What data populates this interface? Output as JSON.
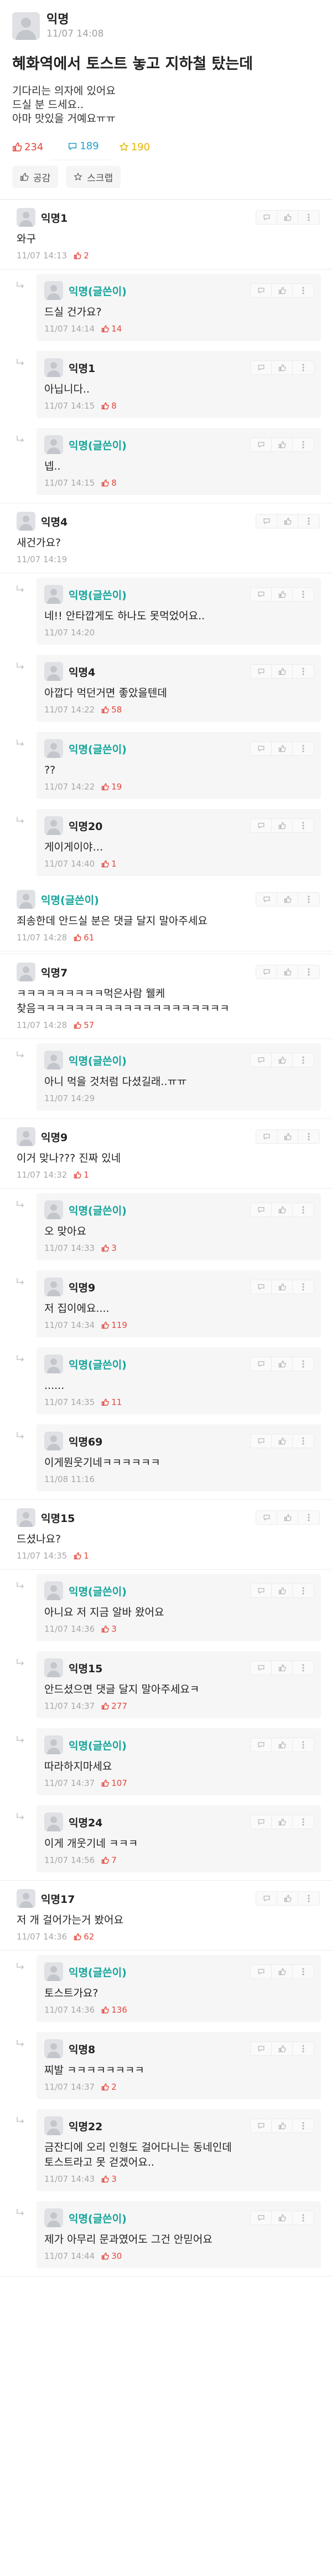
{
  "post": {
    "author": "익명",
    "date": "11/07 14:08",
    "title": "혜화역에서 토스트 놓고 지하철 탔는데",
    "body": [
      "기다리는 의자에 있어요",
      "드실 분 드세요..",
      "아마 맛있을 거예요ㅠㅠ"
    ],
    "likes": "234",
    "comments": "189",
    "scraps": "190",
    "like_button": "공감",
    "scrap_button": "스크랩"
  },
  "icons": {
    "comment_tool": "speech-bubble-icon",
    "like_tool": "thumbs-up-icon",
    "more_tool": "more-vertical-icon"
  },
  "colors": {
    "like": "#e4463b",
    "comment": "#1ea0c8",
    "scrap": "#e6b400",
    "op_name": "#16a59a"
  },
  "comments": [
    {
      "name": "익명1",
      "text": "와구",
      "time": "11/07 14:13",
      "likes": "2",
      "replies": [
        {
          "name": "익명(글쓴이)",
          "op": true,
          "text": "드실 건가요?",
          "time": "11/07 14:14",
          "likes": "14"
        },
        {
          "name": "익명1",
          "op": false,
          "text": "아닙니다..",
          "time": "11/07 14:15",
          "likes": "8"
        },
        {
          "name": "익명(글쓴이)",
          "op": true,
          "text": "넵..",
          "time": "11/07 14:15",
          "likes": "8"
        }
      ]
    },
    {
      "name": "익명4",
      "text": "새건가요?",
      "time": "11/07 14:19",
      "likes": "",
      "replies": [
        {
          "name": "익명(글쓴이)",
          "op": true,
          "text": "네!! 안타깝게도 하나도 못먹었어요..",
          "time": "11/07 14:20",
          "likes": ""
        },
        {
          "name": "익명4",
          "op": false,
          "text": "아깝다 먹던거면 좋았을텐데",
          "time": "11/07 14:22",
          "likes": "58"
        },
        {
          "name": "익명(글쓴이)",
          "op": true,
          "text": "??",
          "time": "11/07 14:22",
          "likes": "19"
        },
        {
          "name": "익명20",
          "op": false,
          "text": "게이게이야…",
          "time": "11/07 14:40",
          "likes": "1"
        },
        {
          "name": "익명(글쓴이)",
          "op": true,
          "text": "죄송한데 안드실 분은 댓글 달지 말아주세요",
          "time": "11/07 14:28",
          "likes": "61",
          "flat": true
        }
      ]
    },
    {
      "name": "익명7",
      "text": "ㅋㅋㅋㅋㅋㅋㅋㅋㅋ먹은사람 웰케",
      "text2": "찾음ㅋㅋㅋㅋㅋㅋㅋㅋㅋㅋㅋㅋㅋㅋㅋㅋㅋㅋㅋㅋ",
      "time": "11/07 14:28",
      "likes": "57",
      "replies": [
        {
          "name": "익명(글쓴이)",
          "op": true,
          "text": "아니 먹을 것처럼 다셨길래..ㅠㅠ",
          "time": "11/07 14:29",
          "likes": ""
        }
      ]
    },
    {
      "name": "익명9",
      "text": "이거 맞나??? 진짜 있네",
      "time": "11/07 14:32",
      "likes": "1",
      "replies": [
        {
          "name": "익명(글쓴이)",
          "op": true,
          "text": "오 맞아요",
          "time": "11/07 14:33",
          "likes": "3"
        },
        {
          "name": "익명9",
          "op": false,
          "text": "저 집이에요....",
          "time": "11/07 14:34",
          "likes": "119"
        },
        {
          "name": "익명(글쓴이)",
          "op": true,
          "text": "......",
          "time": "11/07 14:35",
          "likes": "11"
        },
        {
          "name": "익명69",
          "op": false,
          "text": "이게뭔웃기네ㅋㅋㅋㅋㅋㅋ",
          "time": "11/08 11:16",
          "likes": ""
        }
      ]
    },
    {
      "name": "익명15",
      "text": "드셨나요?",
      "time": "11/07 14:35",
      "likes": "1",
      "replies": [
        {
          "name": "익명(글쓴이)",
          "op": true,
          "text": "아니요 저 지금 알바 왔어요",
          "time": "11/07 14:36",
          "likes": "3"
        },
        {
          "name": "익명15",
          "op": false,
          "text": "안드셨으면 댓글 달지 말아주세요ㅋ",
          "time": "11/07 14:37",
          "likes": "277"
        },
        {
          "name": "익명(글쓴이)",
          "op": true,
          "text": "따라하지마세요",
          "time": "11/07 14:37",
          "likes": "107"
        },
        {
          "name": "익명24",
          "op": false,
          "text": "이게 개웃기네 ㅋㅋㅋ",
          "time": "11/07 14:56",
          "likes": "7"
        }
      ]
    },
    {
      "name": "익명17",
      "text": "저 개 걸어가는거 봤어요",
      "time": "11/07 14:36",
      "likes": "62",
      "replies": [
        {
          "name": "익명(글쓴이)",
          "op": true,
          "text": "토스트가요?",
          "time": "11/07 14:36",
          "likes": "136"
        },
        {
          "name": "익명8",
          "op": false,
          "text": "찌발 ㅋㅋㅋㅋㅋㅋㅋㅋ",
          "time": "11/07 14:37",
          "likes": "2"
        },
        {
          "name": "익명22",
          "op": false,
          "text": "금잔디에 오리 인형도 걸어다니는 동네인데",
          "text2": "토스트라고 못 걷겠어요..",
          "time": "11/07 14:43",
          "likes": "3"
        },
        {
          "name": "익명(글쓴이)",
          "op": true,
          "text": "제가 아무리 문과였어도 그건 안믿어요",
          "time": "11/07 14:44",
          "likes": "30"
        }
      ]
    }
  ]
}
